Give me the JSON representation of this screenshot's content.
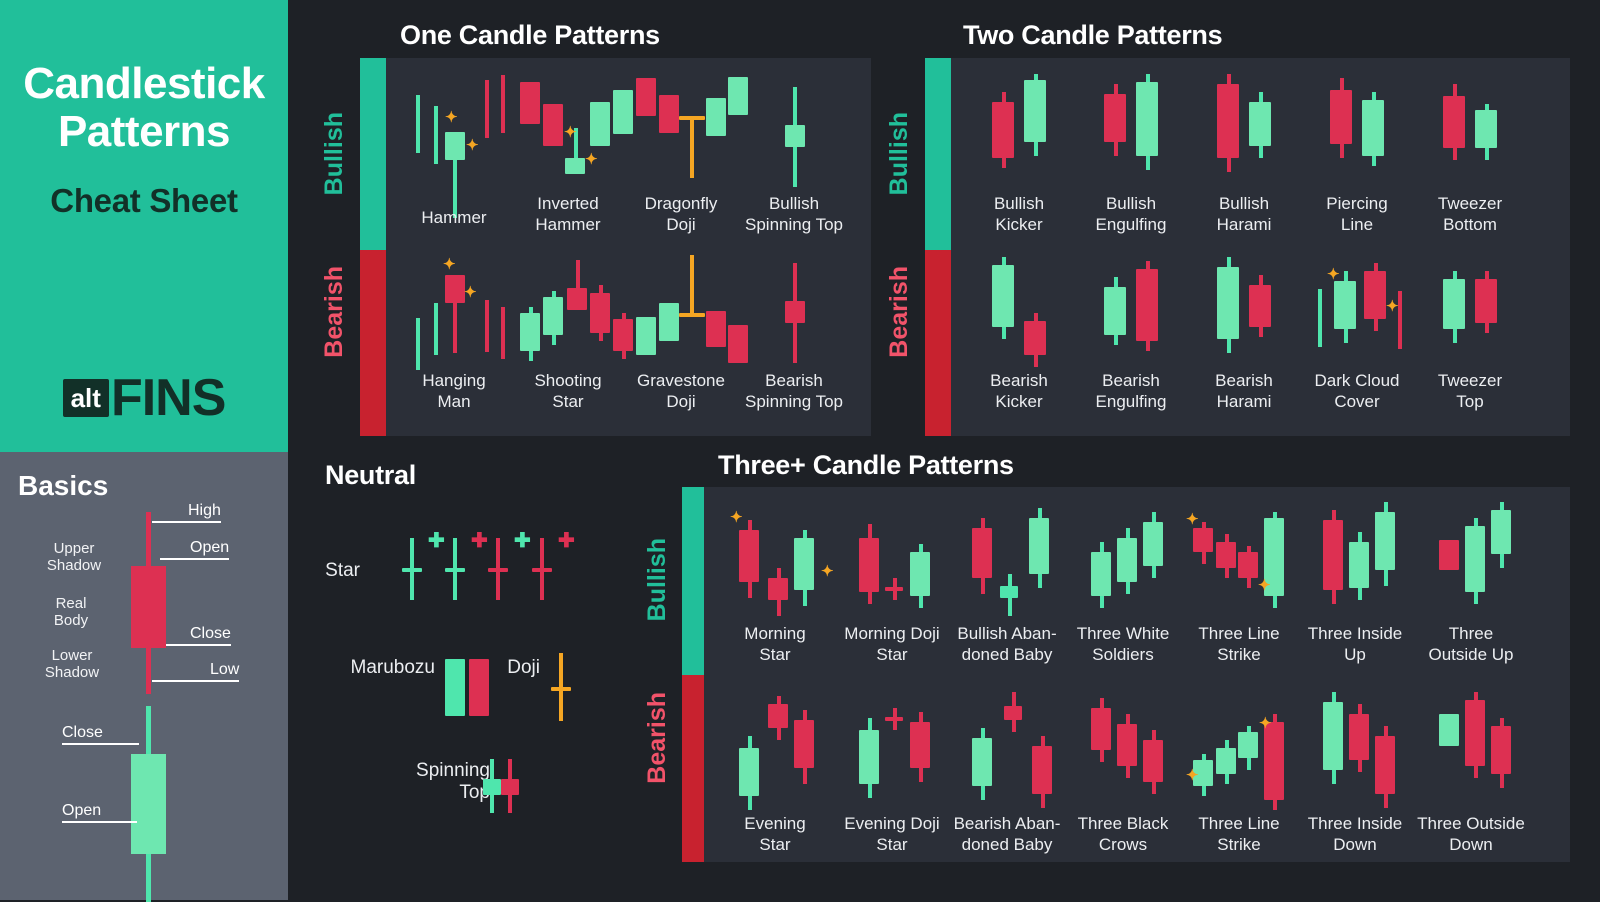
{
  "brand": {
    "title_line1": "Candlestick",
    "title_line2": "Patterns",
    "subtitle": "Cheat Sheet",
    "logo_mark": "alt",
    "logo_word": "FINS"
  },
  "colors": {
    "accent_teal": "#21bf9a",
    "bull_green": "#4fe6ad",
    "bear_red": "#dd3052",
    "sidebar_bear_red": "#c8222f",
    "doji_gold": "#f5a623",
    "panel_bg": "#2b2f38",
    "page_bg": "#1e2126",
    "basics_bg": "#5c6370"
  },
  "basics": {
    "title": "Basics",
    "bearish_candle": {
      "left_labels": [
        "Upper Shadow",
        "Real Body",
        "Lower Shadow"
      ],
      "right_labels": [
        "High",
        "Open",
        "Close",
        "Low"
      ]
    },
    "bullish_candle": {
      "right_labels": [
        "Close",
        "Open"
      ]
    }
  },
  "sections": {
    "one_candle": {
      "title": "One Candle Patterns",
      "bullish_label": "Bullish",
      "bearish_label": "Bearish",
      "bullish": [
        "Hammer",
        "Inverted Hammer",
        "Dragonfly Doji",
        "Bullish Spinning Top"
      ],
      "bearish": [
        "Hanging Man",
        "Shooting Star",
        "Gravestone Doji",
        "Bearish Spinning Top"
      ]
    },
    "two_candle": {
      "title": "Two Candle Patterns",
      "bullish_label": "Bullish",
      "bearish_label": "Bearish",
      "bullish": [
        "Bullish Kicker",
        "Bullish Engulfing",
        "Bullish Harami",
        "Piercing Line",
        "Tweezer Bottom"
      ],
      "bearish": [
        "Bearish Kicker",
        "Bearish Engulfing",
        "Bearish Harami",
        "Dark Cloud Cover",
        "Tweezer Top"
      ]
    },
    "neutral": {
      "title": "Neutral",
      "rows": [
        "Star",
        "Marubozu",
        "Doji",
        "Spinning Top"
      ]
    },
    "three_candle": {
      "title": "Three+ Candle Patterns",
      "bullish_label": "Bullish",
      "bearish_label": "Bearish",
      "bullish": [
        "Morning Star",
        "Morning Doji Star",
        "Bullish Aban-doned Baby",
        "Three White Soldiers",
        "Three Line Strike",
        "Three Inside Up",
        "Three Outside Up"
      ],
      "bearish": [
        "Evening Star",
        "Evening Doji Star",
        "Bearish Aban-doned Baby",
        "Three Black Crows",
        "Three Line Strike",
        "Three Inside Down",
        "Three Outside Down"
      ]
    }
  },
  "labels": {
    "one_bullish": [
      "Hammer",
      "Inverted\nHammer",
      "Dragonfly\nDoji",
      "Bullish\nSpinning Top"
    ],
    "one_bearish": [
      "Hanging\nMan",
      "Shooting\nStar",
      "Gravestone\nDoji",
      "Bearish\nSpinning Top"
    ],
    "two_bullish": [
      "Bullish\nKicker",
      "Bullish\nEngulfing",
      "Bullish\nHarami",
      "Piercing\nLine",
      "Tweezer\nBottom"
    ],
    "two_bearish": [
      "Bearish\nKicker",
      "Bearish\nEngulfing",
      "Bearish\nHarami",
      "Dark Cloud\nCover",
      "Tweezer\nTop"
    ],
    "three_bullish": [
      "Morning\nStar",
      "Morning Doji\nStar",
      "Bullish Aban-\ndoned Baby",
      "Three White\nSoldiers",
      "Three Line\nStrike",
      "Three Inside\nUp",
      "Three\nOutside Up"
    ],
    "three_bearish": [
      "Evening\nStar",
      "Evening Doji\nStar",
      "Bearish Aban-\ndoned Baby",
      "Three Black\nCrows",
      "Three Line\nStrike",
      "Three Inside\nDown",
      "Three Outside\nDown"
    ],
    "neutral_star": "Star",
    "neutral_marubozu": "Marubozu",
    "neutral_doji": "Doji",
    "neutral_spinning_top": "Spinning\nTop"
  },
  "chart_data": {
    "type": "table",
    "title": "Candlestick Patterns Cheat Sheet",
    "groups": [
      {
        "group": "One Candle Patterns",
        "bullish": [
          "Hammer",
          "Inverted Hammer",
          "Dragonfly Doji",
          "Bullish Spinning Top"
        ],
        "bearish": [
          "Hanging Man",
          "Shooting Star",
          "Gravestone Doji",
          "Bearish Spinning Top"
        ]
      },
      {
        "group": "Two Candle Patterns",
        "bullish": [
          "Bullish Kicker",
          "Bullish Engulfing",
          "Bullish Harami",
          "Piercing Line",
          "Tweezer Bottom"
        ],
        "bearish": [
          "Bearish Kicker",
          "Bearish Engulfing",
          "Bearish Harami",
          "Dark Cloud Cover",
          "Tweezer Top"
        ]
      },
      {
        "group": "Neutral",
        "neutral": [
          "Star",
          "Marubozu",
          "Doji",
          "Spinning Top"
        ]
      },
      {
        "group": "Three+ Candle Patterns",
        "bullish": [
          "Morning Star",
          "Morning Doji Star",
          "Bullish Abandoned Baby",
          "Three White Soldiers",
          "Three Line Strike",
          "Three Inside Up",
          "Three Outside Up"
        ],
        "bearish": [
          "Evening Star",
          "Evening Doji Star",
          "Bearish Abandoned Baby",
          "Three Black Crows",
          "Three Line Strike",
          "Three Inside Down",
          "Three Outside Down"
        ]
      }
    ],
    "basics_terms": [
      "Upper Shadow",
      "Real Body",
      "Lower Shadow",
      "High",
      "Open",
      "Close",
      "Low"
    ]
  }
}
